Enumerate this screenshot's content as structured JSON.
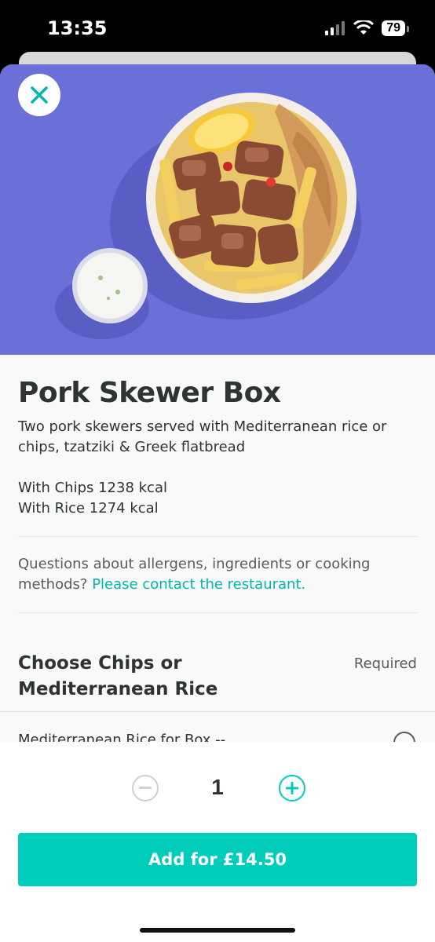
{
  "status": {
    "time": "13:35",
    "battery": "79"
  },
  "item": {
    "title": "Pork Skewer Box",
    "description": "Two pork skewers served with Mediterranean rice or chips, tzatziki & Greek flatbread",
    "kcal_chips": "With Chips 1238 kcal",
    "kcal_rice": "With Rice 1274 kcal"
  },
  "allergen": {
    "text": "Questions about allergens, ingredients or cooking methods?",
    "link": "Please contact the restaurant."
  },
  "option_group": {
    "title": "Choose Chips or Mediterranean Rice",
    "required": "Required",
    "first_option": "Mediterranean Rice for Box --"
  },
  "footer": {
    "quantity": "1",
    "add_label": "Add for £14.50"
  },
  "colors": {
    "accent": "#00ccbc",
    "hero_bg": "#6b6fd8",
    "text": "#2e3333"
  },
  "icons": {
    "close": "close-icon",
    "minus": "minus-icon",
    "plus": "plus-icon"
  }
}
